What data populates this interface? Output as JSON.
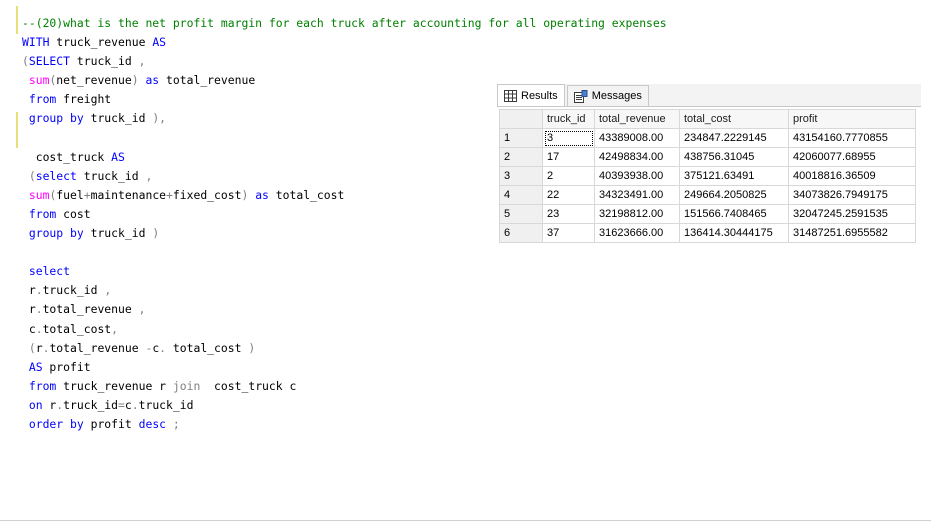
{
  "editor": {
    "lines": [
      [
        {
          "t": "--(20)what is the net profit margin for each truck after accounting for all operating expenses",
          "c": "cm"
        }
      ],
      [
        {
          "t": "WITH",
          "c": "kw"
        },
        {
          "t": " truck_revenue ",
          "c": "id"
        },
        {
          "t": "AS",
          "c": "kw"
        }
      ],
      [
        {
          "t": "(",
          "c": "gr"
        },
        {
          "t": "SELECT",
          "c": "kw"
        },
        {
          "t": " truck_id ",
          "c": "id"
        },
        {
          "t": ",",
          "c": "gr"
        }
      ],
      [
        {
          "t": " ",
          "c": "id"
        },
        {
          "t": "sum",
          "c": "fn"
        },
        {
          "t": "(",
          "c": "gr"
        },
        {
          "t": "net_revenue",
          "c": "id"
        },
        {
          "t": ")",
          "c": "gr"
        },
        {
          "t": " ",
          "c": "id"
        },
        {
          "t": "as",
          "c": "kw"
        },
        {
          "t": " total_revenue",
          "c": "id"
        }
      ],
      [
        {
          "t": " ",
          "c": "id"
        },
        {
          "t": "from",
          "c": "kw"
        },
        {
          "t": " freight",
          "c": "id"
        }
      ],
      [
        {
          "t": " ",
          "c": "id"
        },
        {
          "t": "group by",
          "c": "kw"
        },
        {
          "t": " truck_id ",
          "c": "id"
        },
        {
          "t": "),",
          "c": "gr"
        }
      ],
      [],
      [
        {
          "t": "  cost_truck ",
          "c": "id"
        },
        {
          "t": "AS",
          "c": "kw"
        }
      ],
      [
        {
          "t": " (",
          "c": "gr"
        },
        {
          "t": "select",
          "c": "kw"
        },
        {
          "t": " truck_id ",
          "c": "id"
        },
        {
          "t": ",",
          "c": "gr"
        }
      ],
      [
        {
          "t": " ",
          "c": "id"
        },
        {
          "t": "sum",
          "c": "fn"
        },
        {
          "t": "(",
          "c": "gr"
        },
        {
          "t": "fuel",
          "c": "id"
        },
        {
          "t": "+",
          "c": "gr"
        },
        {
          "t": "maintenance",
          "c": "id"
        },
        {
          "t": "+",
          "c": "gr"
        },
        {
          "t": "fixed_cost",
          "c": "id"
        },
        {
          "t": ")",
          "c": "gr"
        },
        {
          "t": " ",
          "c": "id"
        },
        {
          "t": "as",
          "c": "kw"
        },
        {
          "t": " total_cost",
          "c": "id"
        }
      ],
      [
        {
          "t": " ",
          "c": "id"
        },
        {
          "t": "from",
          "c": "kw"
        },
        {
          "t": " cost",
          "c": "id"
        }
      ],
      [
        {
          "t": " ",
          "c": "id"
        },
        {
          "t": "group by",
          "c": "kw"
        },
        {
          "t": " truck_id ",
          "c": "id"
        },
        {
          "t": ")",
          "c": "gr"
        }
      ],
      [],
      [
        {
          "t": " ",
          "c": "id"
        },
        {
          "t": "select",
          "c": "kw"
        }
      ],
      [
        {
          "t": " r",
          "c": "id"
        },
        {
          "t": ".",
          "c": "gr"
        },
        {
          "t": "truck_id ",
          "c": "id"
        },
        {
          "t": ",",
          "c": "gr"
        }
      ],
      [
        {
          "t": " r",
          "c": "id"
        },
        {
          "t": ".",
          "c": "gr"
        },
        {
          "t": "total_revenue ",
          "c": "id"
        },
        {
          "t": ",",
          "c": "gr"
        }
      ],
      [
        {
          "t": " c",
          "c": "id"
        },
        {
          "t": ".",
          "c": "gr"
        },
        {
          "t": "total_cost",
          "c": "id"
        },
        {
          "t": ",",
          "c": "gr"
        }
      ],
      [
        {
          "t": " (",
          "c": "gr"
        },
        {
          "t": "r",
          "c": "id"
        },
        {
          "t": ".",
          "c": "gr"
        },
        {
          "t": "total_revenue ",
          "c": "id"
        },
        {
          "t": "-",
          "c": "gr"
        },
        {
          "t": "c",
          "c": "id"
        },
        {
          "t": ".",
          "c": "gr"
        },
        {
          "t": " total_cost ",
          "c": "id"
        },
        {
          "t": ")",
          "c": "gr"
        }
      ],
      [
        {
          "t": " ",
          "c": "id"
        },
        {
          "t": "AS",
          "c": "kw"
        },
        {
          "t": " profit",
          "c": "id"
        }
      ],
      [
        {
          "t": " ",
          "c": "id"
        },
        {
          "t": "from",
          "c": "kw"
        },
        {
          "t": " truck_revenue r ",
          "c": "id"
        },
        {
          "t": "join",
          "c": "gr"
        },
        {
          "t": "  cost_truck c",
          "c": "id"
        }
      ],
      [
        {
          "t": " ",
          "c": "id"
        },
        {
          "t": "on",
          "c": "kw"
        },
        {
          "t": " r",
          "c": "id"
        },
        {
          "t": ".",
          "c": "gr"
        },
        {
          "t": "truck_id",
          "c": "id"
        },
        {
          "t": "=",
          "c": "gr"
        },
        {
          "t": "c",
          "c": "id"
        },
        {
          "t": ".",
          "c": "gr"
        },
        {
          "t": "truck_id",
          "c": "id"
        }
      ],
      [
        {
          "t": " ",
          "c": "id"
        },
        {
          "t": "order by",
          "c": "kw"
        },
        {
          "t": " profit ",
          "c": "id"
        },
        {
          "t": "desc",
          "c": "kw"
        },
        {
          "t": " ;",
          "c": "gr"
        }
      ]
    ]
  },
  "results_panel": {
    "tabs": [
      {
        "label": "Results",
        "icon": "grid-icon",
        "active": true
      },
      {
        "label": "Messages",
        "icon": "messages-icon",
        "active": false
      }
    ],
    "columns": [
      "truck_id",
      "total_revenue",
      "total_cost",
      "profit"
    ],
    "rows": [
      {
        "n": "1",
        "cells": [
          "3",
          "43389008.00",
          "234847.2229145",
          "43154160.7770855"
        ]
      },
      {
        "n": "2",
        "cells": [
          "17",
          "42498834.00",
          "438756.31045",
          "42060077.68955"
        ]
      },
      {
        "n": "3",
        "cells": [
          "2",
          "40393938.00",
          "375121.63491",
          "40018816.36509"
        ]
      },
      {
        "n": "4",
        "cells": [
          "22",
          "34323491.00",
          "249664.2050825",
          "34073826.7949175"
        ]
      },
      {
        "n": "5",
        "cells": [
          "23",
          "32198812.00",
          "151566.7408465",
          "32047245.2591535"
        ]
      },
      {
        "n": "6",
        "cells": [
          "37",
          "31623666.00",
          "136414.30444175",
          "31487251.6955582"
        ]
      }
    ]
  },
  "colors": {
    "keyword": "#0000ff",
    "function": "#ff00ff",
    "comment": "#008000",
    "operator": "#808080",
    "change_marker": "#e6e07a"
  }
}
